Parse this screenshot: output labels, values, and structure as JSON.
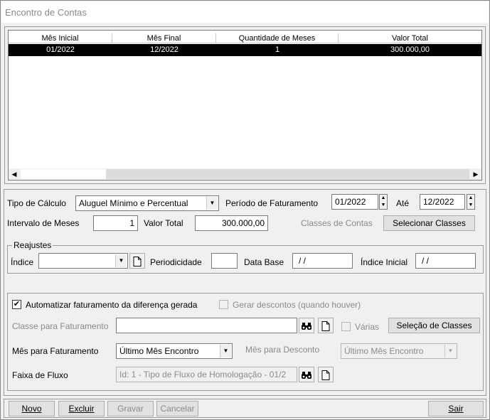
{
  "window": {
    "title": "Encontro de Contas"
  },
  "grid": {
    "columns": [
      "Mês Inicial",
      "Mês Final",
      "Quantidade de Meses",
      "Valor Total"
    ],
    "rows": [
      {
        "mes_inicial": "01/2022",
        "mes_final": "12/2022",
        "quantidade": "1",
        "valor_total": "300.000,00"
      }
    ]
  },
  "calc": {
    "tipo_label": "Tipo de Cálculo",
    "tipo_value": "Aluguel Mínimo e Percentual",
    "periodo_label": "Período de Faturamento",
    "periodo_de": "01/2022",
    "ate_label": "Até",
    "periodo_ate": "12/2022",
    "intervalo_label": "Intervalo de Meses",
    "intervalo_value": "1",
    "valor_total_label": "Valor Total",
    "valor_total_value": "300.000,00",
    "classes_label": "Classes de Contas",
    "selecionar_classes": "Selecionar Classes"
  },
  "reajustes": {
    "title": "Reajustes",
    "indice_label": "Índice",
    "indice_value": "",
    "periodicidade_label": "Periodicidade",
    "periodicidade_value": "",
    "data_base_label": "Data Base",
    "data_base_value": "/ /",
    "indice_inicial_label": "Índice Inicial",
    "indice_inicial_value": "/ /"
  },
  "faturamento": {
    "automatizar_label": "Automatizar faturamento da diferença gerada",
    "automatizar_checked": "✔",
    "gerar_descontos_label": "Gerar descontos (quando houver)",
    "classe_label": "Classe para Faturamento",
    "classe_value": "",
    "varias_label": "Várias",
    "selecao_classes": "Seleção de Classes",
    "mes_faturamento_label": "Mês para Faturamento",
    "mes_faturamento_value": "Último Mês Encontro",
    "mes_desconto_label": "Mês para Desconto",
    "mes_desconto_value": "Último Mês Encontro",
    "faixa_label": "Faixa de Fluxo",
    "faixa_value": "Id: 1 - Tipo de Fluxo de Homologação - 01/2"
  },
  "buttons": {
    "novo": "Novo",
    "excluir": "Excluir",
    "gravar": "Gravar",
    "cancelar": "Cancelar",
    "sair": "Sair"
  }
}
